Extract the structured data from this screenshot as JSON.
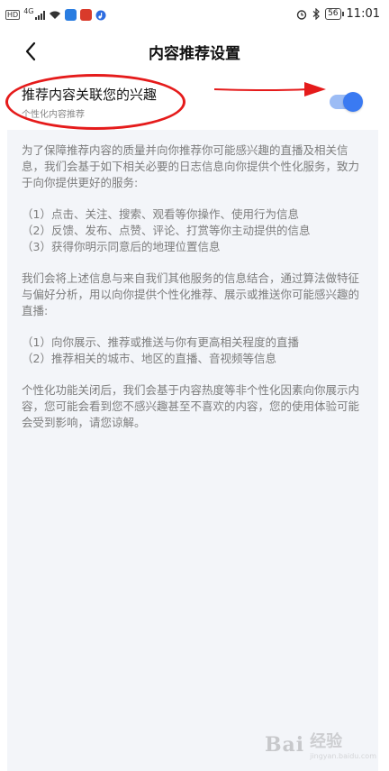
{
  "status_bar": {
    "hd": "HD",
    "network": "4G",
    "battery": "56",
    "time": "11:01",
    "icons": [
      "signal-icon",
      "wifi-icon",
      "app-icon",
      "app-icon",
      "music-icon",
      "alarm-icon",
      "bluetooth-icon",
      "battery-icon"
    ]
  },
  "header": {
    "title": "内容推荐设置",
    "back_icon": "chevron-left-icon"
  },
  "setting": {
    "label": "推荐内容关联您的兴趣",
    "sublabel": "个性化内容推荐",
    "enabled": true,
    "accent_color": "#3a7af2"
  },
  "info": {
    "para1": "为了保障推荐内容的质量并向你推荐你可能感兴趣的直播及相关信息，我们会基于如下相关必要的日志信息向你提供个性化服务，致力于向你提供更好的服务:",
    "list1": [
      "（1）点击、关注、搜索、观看等你操作、使用行为信息",
      "（2）反馈、发布、点赞、评论、打赏等你主动提供的信息",
      "（3）获得你明示同意后的地理位置信息"
    ],
    "para2": "我们会将上述信息与来自我们其他服务的信息结合，通过算法做特征与偏好分析，用以向你提供个性化推荐、展示或推送你可能感兴趣的直播:",
    "list2": [
      "（1）向你展示、推荐或推送与你有更高相关程度的直播",
      "（2）推荐相关的城市、地区的直播、音视频等信息"
    ],
    "para3": "个性化功能关闭后，我们会基于内容热度等非个性化因素向你展示内容，您可能会看到您不感兴趣甚至不喜欢的内容，您的使用体验可能会受到影响，请您谅解。"
  },
  "watermark": {
    "brand": "Bai",
    "title": "经验",
    "url": "jingyan.baidu.com"
  }
}
